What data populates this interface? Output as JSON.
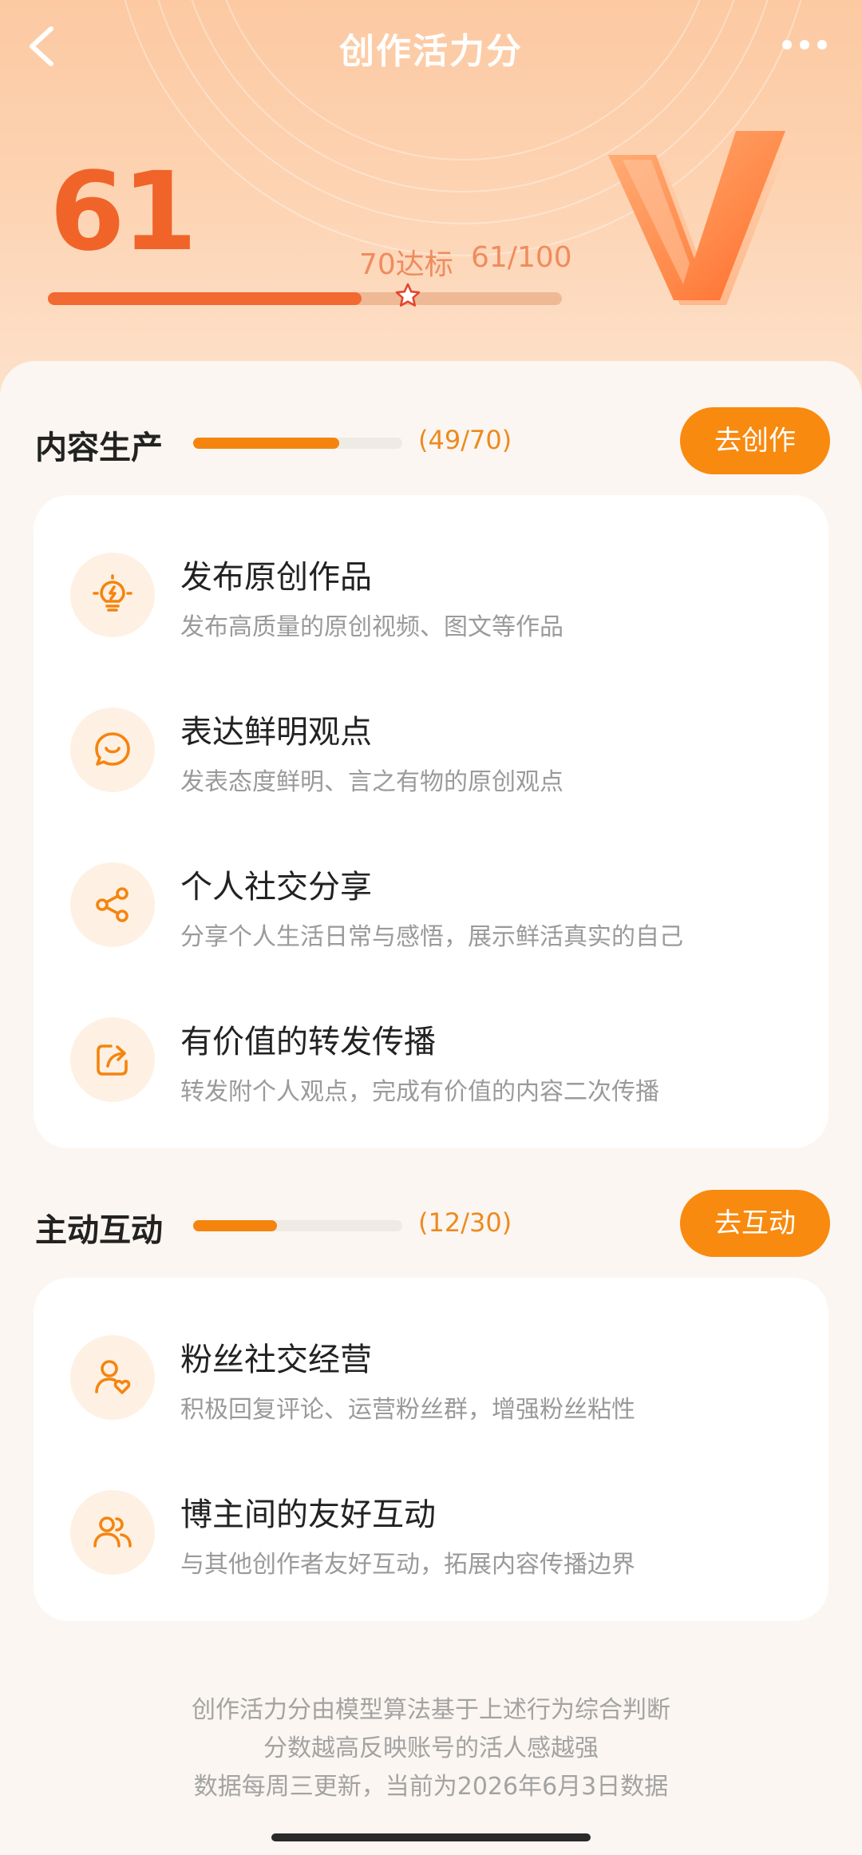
{
  "header": {
    "title": "创作活力分",
    "back_icon": "chevron-left-icon",
    "more_icon": "more-horizontal-icon"
  },
  "score": {
    "value": "61",
    "target_label": "70达标",
    "progress_text": "61/100",
    "progress": 0.61,
    "target": 0.7,
    "target_icon": "star-icon",
    "badge_icon": "v-badge-icon"
  },
  "sections": [
    {
      "title": "内容生产",
      "count": "(49/70)",
      "progress": 0.7,
      "button": "去创作",
      "items": [
        {
          "icon": "lightbulb-icon",
          "title": "发布原创作品",
          "desc": "发布高质量的原创视频、图文等作品"
        },
        {
          "icon": "chat-smile-icon",
          "title": "表达鲜明观点",
          "desc": "发表态度鲜明、言之有物的原创观点"
        },
        {
          "icon": "share-icon",
          "title": "个人社交分享",
          "desc": "分享个人生活日常与感悟，展示鲜活真实的自己"
        },
        {
          "icon": "forward-icon",
          "title": "有价值的转发传播",
          "desc": "转发附个人观点，完成有价值的内容二次传播"
        }
      ]
    },
    {
      "title": "主动互动",
      "count": "(12/30)",
      "progress": 0.4,
      "button": "去互动",
      "items": [
        {
          "icon": "user-heart-icon",
          "title": "粉丝社交经营",
          "desc": "积极回复评论、运营粉丝群，增强粉丝粘性"
        },
        {
          "icon": "users-icon",
          "title": "博主间的友好互动",
          "desc": "与其他创作者友好互动，拓展内容传播边界"
        }
      ]
    }
  ],
  "footer": {
    "line1": "创作活力分由模型算法基于上述行为综合判断",
    "line2": "分数越高反映账号的活人感越强",
    "line3": "数据每周三更新，当前为2026年6月3日数据"
  },
  "colors": {
    "accent": "#f88a0f",
    "score": "#f0642a",
    "hero_bg": "#fdd3b2"
  }
}
